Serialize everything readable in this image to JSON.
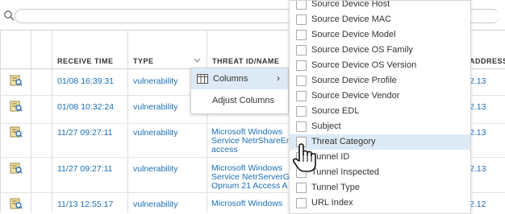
{
  "search": {
    "placeholder": ""
  },
  "table": {
    "columns": [
      "",
      "",
      "RECEIVE TIME",
      "TYPE",
      "THREAT ID/NAME",
      "ADDRESS"
    ],
    "rows": [
      {
        "time": "01/08 16:39:31",
        "type": "vulnerability",
        "threat": [],
        "address": "2.13"
      },
      {
        "time": "01/08 10:32:24",
        "type": "vulnerability",
        "threat": [],
        "address": "2.13"
      },
      {
        "time": "11/27 09:27:11",
        "type": "vulnerability",
        "threat": [
          "Microsoft Windows",
          "Service NetrShareEn",
          "access"
        ],
        "address": "2.13"
      },
      {
        "time": "11/27 09:27:11",
        "type": "vulnerability",
        "threat": [
          "Microsoft Windows",
          "Service NetrServerG",
          "Opnum 21 Access A"
        ],
        "address": "2.13"
      },
      {
        "time": "11/13 12:55:17",
        "type": "vulnerability",
        "threat": [
          "Microsoft Windows",
          ""
        ],
        "address": "2.12"
      }
    ]
  },
  "context_menu": {
    "columns_label": "Columns",
    "adjust_label": "Adjust Columns",
    "chevron": "›"
  },
  "column_submenu": {
    "items": [
      "Source Device Host",
      "Source Device MAC",
      "Source Device Model",
      "Source Device OS Family",
      "Source Device OS Version",
      "Source Device Profile",
      "Source Device Vendor",
      "Source EDL",
      "Subject",
      "Threat Category",
      "Tunnel ID",
      "Tunnel Inspected",
      "Tunnel Type",
      "URL Index"
    ],
    "highlighted_index": 9
  },
  "colors": {
    "link": "#1b6fb7",
    "highlight": "#dde9f5",
    "border": "#d5d5d5"
  },
  "icons": {
    "row": "log-detail-icon",
    "search": "search-icon",
    "columns": "columns-icon",
    "cursor": "hand-pointer-icon"
  }
}
